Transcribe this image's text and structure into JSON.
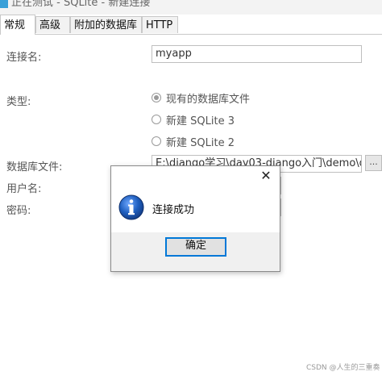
{
  "window": {
    "title": "正在测试 - SQLite - 新建连接"
  },
  "tabs": [
    {
      "label": "常规",
      "active": true
    },
    {
      "label": "高级",
      "active": false
    },
    {
      "label": "附加的数据库",
      "active": false
    },
    {
      "label": "HTTP",
      "active": false
    }
  ],
  "form": {
    "connection_name_label": "连接名:",
    "connection_name_value": "myapp",
    "type_label": "类型:",
    "type_options": [
      {
        "label": "现有的数据库文件",
        "checked": true
      },
      {
        "label": "新建 SQLite 3",
        "checked": false
      },
      {
        "label": "新建 SQLite 2",
        "checked": false
      }
    ],
    "db_file_label": "数据库文件:",
    "db_file_value": "E:\\django学习\\day03-django入门\\demo\\d",
    "browse_label": "...",
    "username_label": "用户名:",
    "password_label": "密码:"
  },
  "dialog": {
    "message": "连接成功",
    "ok_label": "确定",
    "close_glyph": "✕"
  },
  "watermark": "CSDN @人生的三重奏",
  "colors": {
    "accent": "#0078d7",
    "info_icon_blue": "#1f5fbf"
  }
}
